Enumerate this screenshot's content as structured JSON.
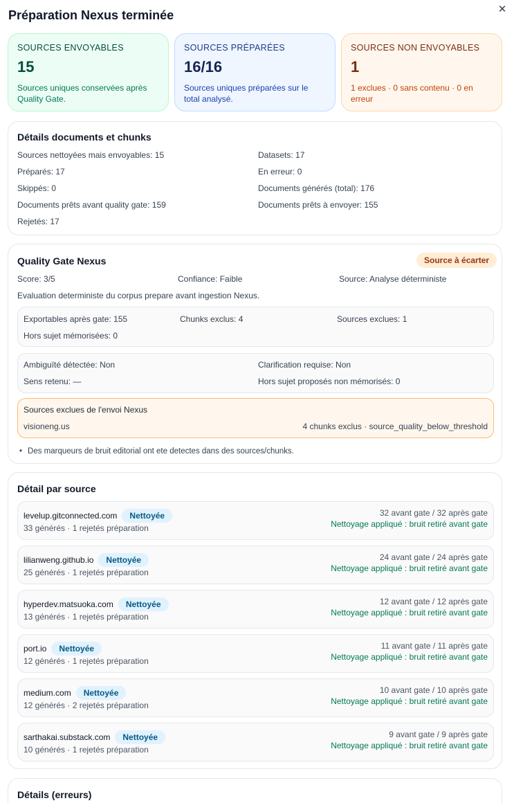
{
  "header": {
    "title": "Préparation Nexus terminée",
    "close_label": "✕"
  },
  "kpis": {
    "sendable": {
      "label": "SOURCES ENVOYABLES",
      "value": "15",
      "desc": "Sources uniques conservées après Quality Gate."
    },
    "prepared": {
      "label": "SOURCES PRÉPARÉES",
      "value": "16/16",
      "desc": "Sources uniques préparées sur le total analysé."
    },
    "not_sendable": {
      "label": "SOURCES NON ENVOYABLES",
      "value": "1",
      "desc": "1 exclues · 0 sans contenu · 0 en erreur"
    }
  },
  "details": {
    "title": "Détails documents et chunks",
    "left": [
      "Sources nettoyées mais envoyables: 15",
      "Préparés: 17",
      "Skippés: 0",
      "Documents prêts avant quality gate: 159",
      "Rejetés: 17"
    ],
    "right": [
      "Datasets: 17",
      "En erreur: 0",
      "Documents générés (total): 176",
      "Documents prêts à envoyer: 155"
    ]
  },
  "quality_gate": {
    "title": "Quality Gate Nexus",
    "badge": "Source à écarter",
    "score": "Score: 3/5",
    "confidence": "Confiance: Faible",
    "source": "Source: Analyse déterministe",
    "description": "Evaluation deterministe du corpus prepare avant ingestion Nexus.",
    "box1": {
      "exportables": "Exportables après gate: 155",
      "chunks_excluded": "Chunks exclus: 4",
      "sources_excluded": "Sources exclues: 1",
      "off_topic": "Hors sujet mémorisées: 0"
    },
    "box2": {
      "ambiguity": "Ambiguïté détectée: Non",
      "clarification": "Clarification requise: Non",
      "meaning": "Sens retenu: —",
      "off_topic_proposed": "Hors sujet proposés non mémorisés: 0"
    },
    "excluded": {
      "title": "Sources exclues de l'envoi Nexus",
      "domain": "visioneng.us",
      "reason": "4 chunks exclus · source_quality_below_threshold"
    },
    "note": "Des marqueurs de bruit editorial ont ete detectes dans des sources/chunks."
  },
  "per_source": {
    "title": "Détail par source",
    "rows": [
      {
        "name": "levelup.gitconnected.com",
        "badge": "Nettoyée",
        "sub": "33 générés · 1 rejetés préparation",
        "gate": "32 avant gate / 32 après gate",
        "cleaning": "Nettoyage appliqué : bruit retiré avant gate"
      },
      {
        "name": "lilianweng.github.io",
        "badge": "Nettoyée",
        "sub": "25 générés · 1 rejetés préparation",
        "gate": "24 avant gate / 24 après gate",
        "cleaning": "Nettoyage appliqué : bruit retiré avant gate"
      },
      {
        "name": "hyperdev.matsuoka.com",
        "badge": "Nettoyée",
        "sub": "13 générés · 1 rejetés préparation",
        "gate": "12 avant gate / 12 après gate",
        "cleaning": "Nettoyage appliqué : bruit retiré avant gate"
      },
      {
        "name": "port.io",
        "badge": "Nettoyée",
        "sub": "12 générés · 1 rejetés préparation",
        "gate": "11 avant gate / 11 après gate",
        "cleaning": "Nettoyage appliqué : bruit retiré avant gate"
      },
      {
        "name": "medium.com",
        "badge": "Nettoyée",
        "sub": "12 générés · 2 rejetés préparation",
        "gate": "10 avant gate / 10 après gate",
        "cleaning": "Nettoyage appliqué : bruit retiré avant gate"
      },
      {
        "name": "sarthakai.substack.com",
        "badge": "Nettoyée",
        "sub": "10 générés · 1 rejetés préparation",
        "gate": "9 avant gate / 9 après gate",
        "cleaning": "Nettoyage appliqué : bruit retiré avant gate"
      }
    ]
  },
  "errors": {
    "title": "Détails (erreurs)"
  }
}
